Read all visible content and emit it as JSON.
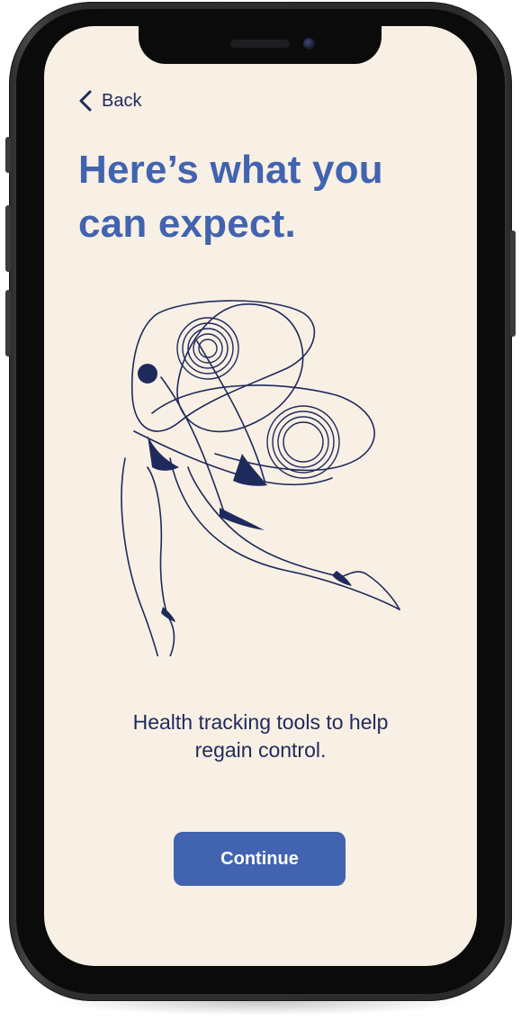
{
  "nav": {
    "back_label": "Back"
  },
  "main": {
    "title_line1": "Here’s what you",
    "title_line2": "can expect.",
    "subtitle_line1": "Health tracking tools to help",
    "subtitle_line2": "regain control.",
    "continue_label": "Continue"
  },
  "illustration": {
    "icon": "abstract-figure-line-art"
  },
  "colors": {
    "background": "#f8f0e4",
    "accent": "#4163b0",
    "ink": "#1f2a5c",
    "device_frame": "#2b2b2d"
  }
}
